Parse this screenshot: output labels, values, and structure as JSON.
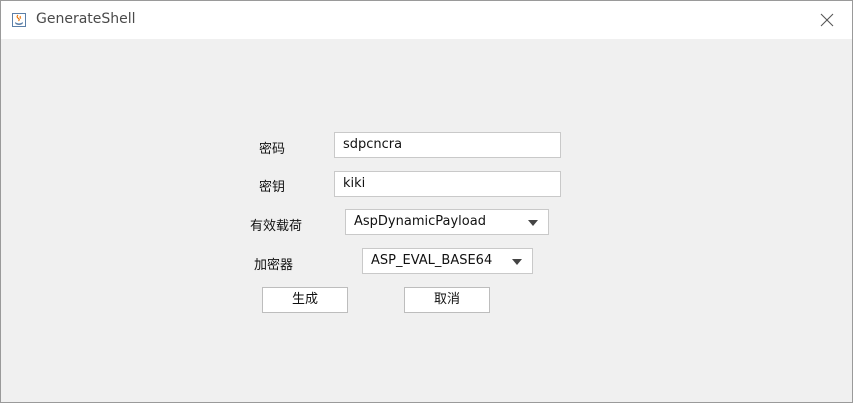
{
  "window": {
    "title": "GenerateShell",
    "app_icon": "java-cup-icon",
    "close_icon": "close-icon"
  },
  "form": {
    "password_label": "密码",
    "password_value": "sdpcncra",
    "key_label": "密钥",
    "key_value": "kiki",
    "payload_label": "有效载荷",
    "payload_selected": "AspDynamicPayload",
    "encryptor_label": "加密器",
    "encryptor_selected": "ASP_EVAL_BASE64"
  },
  "buttons": {
    "generate_label": "生成",
    "cancel_label": "取消"
  },
  "colors": {
    "background": "#f0f0f0",
    "titlebar": "#ffffff",
    "field_border": "#c9c9c9"
  }
}
